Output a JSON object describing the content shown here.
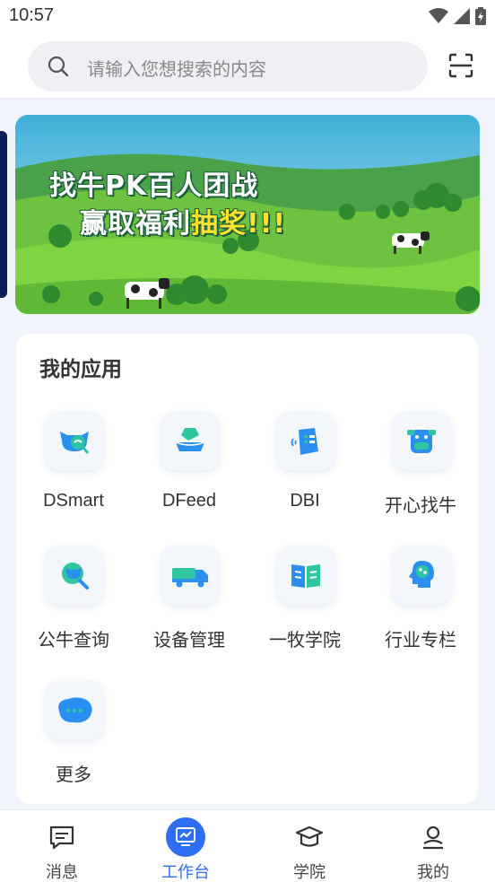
{
  "status_bar": {
    "time": "10:57",
    "icons": [
      "wifi-icon",
      "signal-icon",
      "battery-icon"
    ]
  },
  "search": {
    "placeholder": "请输入您想搜索的内容",
    "icon": "search-icon",
    "scan_icon": "scan-icon"
  },
  "banner": {
    "line1": "找牛PK百人团战",
    "line2_main": "赢取福利",
    "line2_highlight": "抽奖!!!"
  },
  "apps": {
    "title": "我的应用",
    "items": [
      {
        "label": "DSmart",
        "icon": "cow-link-icon"
      },
      {
        "label": "DFeed",
        "icon": "feed-trough-icon"
      },
      {
        "label": "DBI",
        "icon": "report-bag-icon"
      },
      {
        "label": "开心找牛",
        "icon": "cow-face-icon"
      },
      {
        "label": "公牛查询",
        "icon": "bull-search-icon"
      },
      {
        "label": "设备管理",
        "icon": "truck-icon"
      },
      {
        "label": "一牧学院",
        "icon": "open-book-icon"
      },
      {
        "label": "行业专栏",
        "icon": "brain-head-icon"
      },
      {
        "label": "更多",
        "icon": "more-icon"
      }
    ]
  },
  "tabbar": {
    "items": [
      {
        "label": "消息",
        "icon": "message-icon",
        "active": false
      },
      {
        "label": "工作台",
        "icon": "workbench-icon",
        "active": true
      },
      {
        "label": "学院",
        "icon": "graduation-cap-icon",
        "active": false
      },
      {
        "label": "我的",
        "icon": "user-icon",
        "active": false
      }
    ]
  },
  "colors": {
    "accent": "#2f6df2",
    "icon_blue": "#2b8ff0",
    "icon_green": "#2ec6a0",
    "banner_highlight": "#ffe230"
  }
}
